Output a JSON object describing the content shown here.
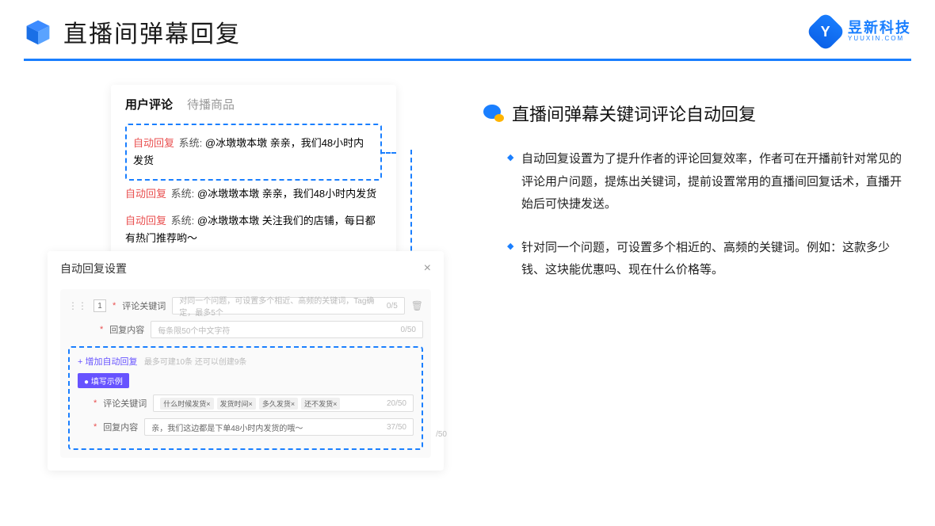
{
  "header": {
    "title": "直播间弹幕回复",
    "logo_cn": "昱新科技",
    "logo_en": "YUUXIN.COM",
    "logo_letter": "Y"
  },
  "comment_card": {
    "tabs": {
      "active": "用户评论",
      "inactive": "待播商品"
    },
    "rows": [
      {
        "tag": "自动回复",
        "sys": "系统:",
        "text": "@冰墩墩本墩 亲亲，我们48小时内发货"
      },
      {
        "tag": "自动回复",
        "sys": "系统:",
        "text": "@冰墩墩本墩 亲亲，我们48小时内发货"
      },
      {
        "tag": "自动回复",
        "sys": "系统:",
        "text": "@冰墩墩本墩 关注我们的店铺，每日都有热门推荐哟～"
      }
    ]
  },
  "settings": {
    "title": "自动回复设置",
    "row_num": "1",
    "label_keyword": "评论关键词",
    "placeholder_keyword": "对同一个问题，可设置多个相近、高频的关键词，Tag确定，最多5个",
    "counter_keyword": "0/5",
    "label_reply": "回复内容",
    "placeholder_reply": "每条限50个中文字符",
    "counter_reply": "0/50",
    "add_link": "+ 增加自动回复",
    "add_hint": "最多可建10条 还可以创建9条",
    "example_badge": "● 填写示例",
    "example_tags": [
      "什么时候发货×",
      "发货时间×",
      "多久发货×",
      "还不发货×"
    ],
    "example_counter_kw": "20/50",
    "example_reply_text": "亲，我们这边都是下单48小时内发货的哦～",
    "example_counter_reply": "37/50",
    "outer_counter": "/50"
  },
  "right": {
    "section_title": "直播间弹幕关键词评论自动回复",
    "bullets": [
      "自动回复设置为了提升作者的评论回复效率，作者可在开播前针对常见的评论用户问题，提炼出关键词，提前设置常用的直播间回复话术，直播开始后可快捷发送。",
      "针对同一个问题，可设置多个相近的、高频的关键词。例如：这款多少钱、这块能优惠吗、现在什么价格等。"
    ]
  }
}
